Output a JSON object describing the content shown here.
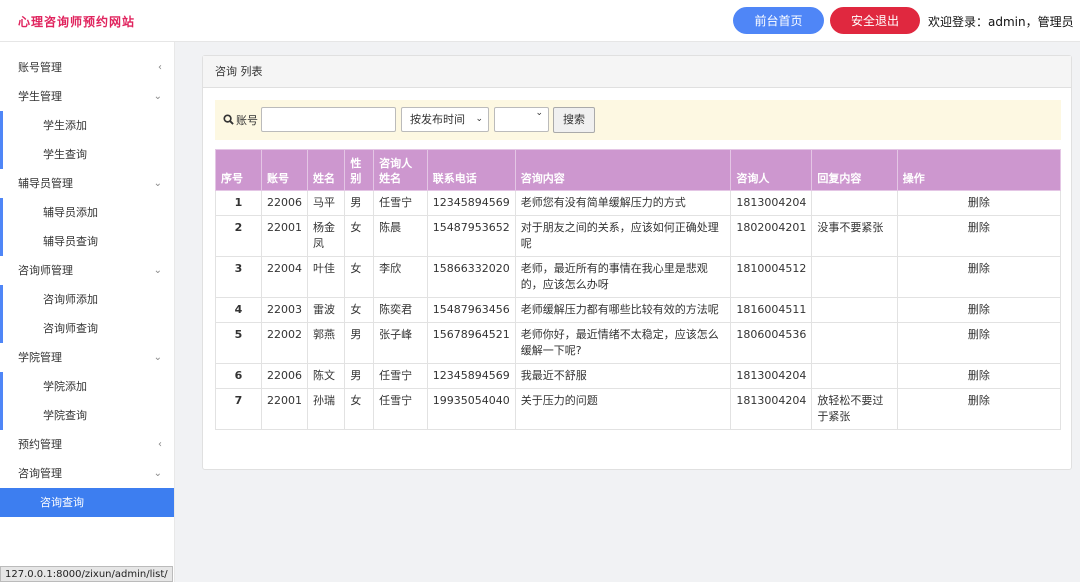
{
  "header": {
    "title": "心理咨询师预约网站",
    "home_label": "前台首页",
    "logout_label": "安全退出",
    "welcome": "欢迎登录：admin，管理员"
  },
  "sidebar": {
    "items": [
      {
        "label": "账号管理",
        "arrow": "‹"
      },
      {
        "label": "学生管理",
        "arrow": "⌄"
      },
      {
        "label": "学生添加"
      },
      {
        "label": "学生查询"
      },
      {
        "label": "辅导员管理",
        "arrow": "⌄"
      },
      {
        "label": "辅导员添加"
      },
      {
        "label": "辅导员查询"
      },
      {
        "label": "咨询师管理",
        "arrow": "⌄"
      },
      {
        "label": "咨询师添加"
      },
      {
        "label": "咨询师查询"
      },
      {
        "label": "学院管理",
        "arrow": "⌄"
      },
      {
        "label": "学院添加"
      },
      {
        "label": "学院查询"
      },
      {
        "label": "预约管理",
        "arrow": "‹"
      },
      {
        "label": "咨询管理",
        "arrow": "⌄"
      },
      {
        "label": "咨询查询"
      }
    ]
  },
  "status_url": "127.0.0.1:8000/zixun/admin/list/",
  "panel": {
    "title": "咨询 列表"
  },
  "search": {
    "label": "账号",
    "input_value": "",
    "select_value": "按发布时间",
    "select2_value": "",
    "button_label": "搜索"
  },
  "table": {
    "headers": [
      "序号",
      "账号",
      "姓名",
      "性别",
      "咨询人姓名",
      "联系电话",
      "咨询内容",
      "咨询人",
      "回复内容",
      "操作"
    ],
    "rows": [
      [
        "1",
        "22006",
        "马平",
        "男",
        "任雪宁",
        "12345894569",
        "老师您有没有简单缓解压力的方式",
        "1813004204",
        "",
        "删除"
      ],
      [
        "2",
        "22001",
        "杨金凤",
        "女",
        "陈晨",
        "15487953652",
        "对于朋友之间的关系，应该如何正确处理呢",
        "1802004201",
        "没事不要紧张",
        "删除"
      ],
      [
        "3",
        "22004",
        "叶佳",
        "女",
        "李欣",
        "15866332020",
        "老师，最近所有的事情在我心里是悲观的，应该怎么办呀",
        "1810004512",
        "",
        "删除"
      ],
      [
        "4",
        "22003",
        "雷波",
        "女",
        "陈奕君",
        "15487963456",
        "老师缓解压力都有哪些比较有效的方法呢",
        "1816004511",
        "",
        "删除"
      ],
      [
        "5",
        "22002",
        "郭燕",
        "男",
        "张子峰",
        "15678964521",
        "老师你好，最近情绪不太稳定，应该怎么缓解一下呢?",
        "1806004536",
        "",
        "删除"
      ],
      [
        "6",
        "22006",
        "陈文",
        "男",
        "任雪宁",
        "12345894569",
        "我最近不舒服",
        "1813004204",
        "",
        "删除"
      ],
      [
        "7",
        "22001",
        "孙瑞",
        "女",
        "任雪宁",
        "19935054040",
        "关于压力的问题",
        "1813004204",
        "放轻松不要过于紧张",
        "删除"
      ]
    ]
  }
}
